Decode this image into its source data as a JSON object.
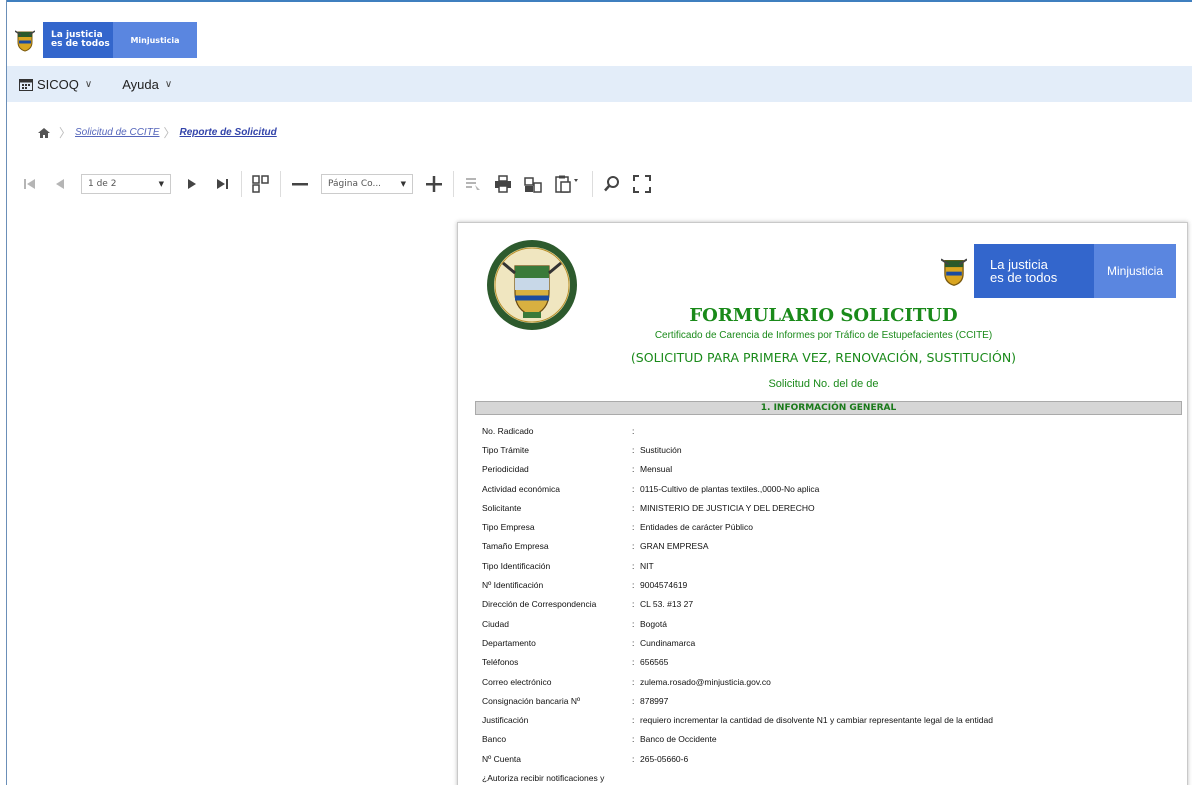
{
  "brand": {
    "line1": "La justicia",
    "line2": "es de todos",
    "ministry": "Minjusticia"
  },
  "menu": [
    {
      "label": "SICOQ",
      "icon": "calendar-icon"
    },
    {
      "label": "Ayuda"
    }
  ],
  "breadcrumb": {
    "item1": "Solicitud de CCITE",
    "item2": "Reporte de Solicitud"
  },
  "toolbar": {
    "page_select": "1 de 2",
    "zoom_select": "Página Co..."
  },
  "report": {
    "brand_line1": "La justicia",
    "brand_line2": "es de todos",
    "brand_ministry": "Minjusticia",
    "title": "FORMULARIO SOLICITUD",
    "subtitle": "Certificado de Carencia de Informes por Tráfico de Estupefacientes (CCITE)",
    "type": "(SOLICITUD PARA PRIMERA VEZ, RENOVACIÓN, SUSTITUCIÓN)",
    "number_line": "Solicitud No.  del  de  de",
    "section1": "1. INFORMACIÓN GENERAL",
    "fields": [
      {
        "label": "No. Radicado",
        "value": ""
      },
      {
        "label": "Tipo Trámite",
        "value": "Sustitución"
      },
      {
        "label": "Periodicidad",
        "value": "Mensual"
      },
      {
        "label": "Actividad económica",
        "value": "0115-Cultivo de plantas textiles.,0000-No aplica"
      },
      {
        "label": "Solicitante",
        "value": "MINISTERIO DE JUSTICIA Y DEL DERECHO"
      },
      {
        "label": "Tipo Empresa",
        "value": "Entidades de carácter Público"
      },
      {
        "label": "Tamaño Empresa",
        "value": "GRAN EMPRESA"
      },
      {
        "label": "Tipo Identificación",
        "value": "NIT"
      },
      {
        "label": "Nº Identificación",
        "value": "9004574619"
      },
      {
        "label": "Dirección de Correspondencia",
        "value": "CL 53. #13 27"
      },
      {
        "label": "Ciudad",
        "value": "Bogotá"
      },
      {
        "label": "Departamento",
        "value": "Cundinamarca"
      },
      {
        "label": "Teléfonos",
        "value": "656565"
      },
      {
        "label": "Correo electrónico",
        "value": "zulema.rosado@minjusticia.gov.co"
      },
      {
        "label": "Consignación bancaria Nº",
        "value": "878997"
      },
      {
        "label": "Justificación",
        "value": "requiero incrementar la cantidad de disolvente N1 y cambiar representante legal de la entidad"
      },
      {
        "label": "Banco",
        "value": "Banco de Occidente"
      },
      {
        "label": "Nº Cuenta",
        "value": "265-05660-6"
      },
      {
        "label": "¿Autoriza recibir notificaciones y",
        "value": null
      }
    ]
  },
  "colors": {
    "accent": "#3366cc",
    "green": "#1a8a1a",
    "menubar": "#e3edf9"
  }
}
